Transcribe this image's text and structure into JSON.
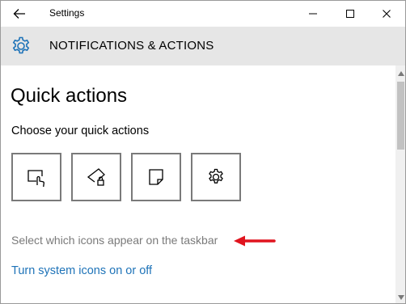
{
  "window": {
    "title": "Settings",
    "back_icon": "back-arrow-icon",
    "controls": [
      "minimize-icon",
      "maximize-icon",
      "close-icon"
    ]
  },
  "header": {
    "icon": "gear-icon",
    "title": "NOTIFICATIONS & ACTIONS",
    "band_color": "#e6e6e6"
  },
  "main": {
    "section_title": "Quick actions",
    "subtitle": "Choose your quick actions",
    "quick_actions": [
      {
        "icon": "tablet-mode-icon"
      },
      {
        "icon": "location-icon"
      },
      {
        "icon": "note-icon"
      },
      {
        "icon": "settings-icon"
      }
    ],
    "taskbar_prompt": "Select which icons appear on the taskbar",
    "system_icons_link": "Turn system icons on or off",
    "link_color": "#1e73b8",
    "annotation_arrow_color": "#e0141e"
  }
}
